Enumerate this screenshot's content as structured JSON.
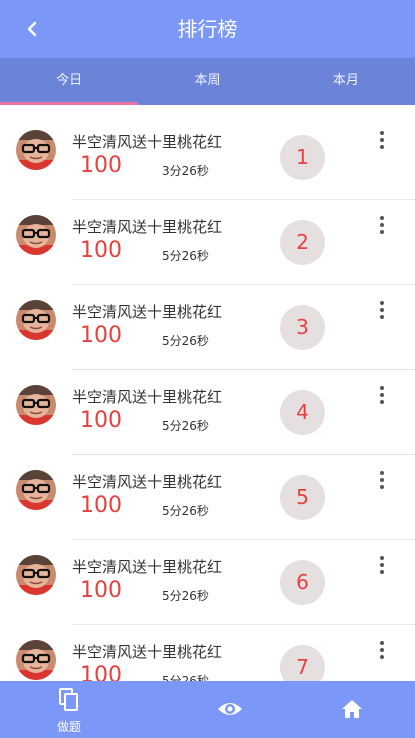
{
  "header": {
    "title": "排行榜",
    "back_icon": "chevron-left-icon"
  },
  "tabs": [
    {
      "label": "今日",
      "active": true
    },
    {
      "label": "本周",
      "active": false
    },
    {
      "label": "本月",
      "active": false
    }
  ],
  "colors": {
    "header_bg": "#7b97f7",
    "tabs_bg": "#6b84d8",
    "indicator": "#ef6fa8",
    "score": "#e84040",
    "rank_badge_bg": "#e6dfe0"
  },
  "leaderboard": [
    {
      "name": "半空清风送十里桃花红",
      "score": "100",
      "time": "3分26秒",
      "rank": "1"
    },
    {
      "name": "半空清风送十里桃花红",
      "score": "100",
      "time": "5分26秒",
      "rank": "2"
    },
    {
      "name": "半空清风送十里桃花红",
      "score": "100",
      "time": "5分26秒",
      "rank": "3"
    },
    {
      "name": "半空清风送十里桃花红",
      "score": "100",
      "time": "5分26秒",
      "rank": "4"
    },
    {
      "name": "半空清风送十里桃花红",
      "score": "100",
      "time": "5分26秒",
      "rank": "5"
    },
    {
      "name": "半空清风送十里桃花红",
      "score": "100",
      "time": "5分26秒",
      "rank": "6"
    },
    {
      "name": "半空清风送十里桃花红",
      "score": "100",
      "time": "5分26秒",
      "rank": "7"
    }
  ],
  "bottom_nav": [
    {
      "label": "做题",
      "icon": "copy-icon"
    },
    {
      "label": "",
      "icon": "eye-icon"
    },
    {
      "label": "",
      "icon": "home-icon"
    }
  ]
}
